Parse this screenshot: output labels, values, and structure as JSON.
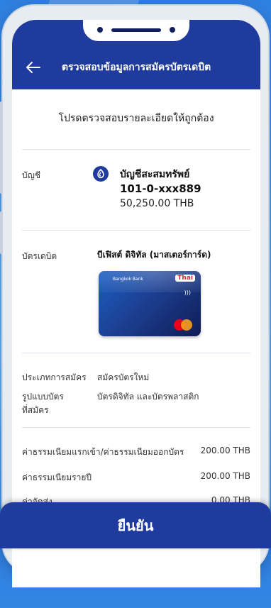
{
  "header": {
    "title": "ตรวจสอบข้อมูลการสมัครบัตรเดบิต"
  },
  "instruction": "โปรดตรวจสอบรายละเอียดให้ถูกต้อง",
  "account": {
    "label": "บัญชี",
    "type": "บัญชีสะสมทรัพย์",
    "number": "101-0-xxx889",
    "balance": "50,250.00 THB"
  },
  "debit_card": {
    "label": "บัตรเดบิต",
    "name": "บีเฟิสต์ ดิจิทัล (มาสเตอร์การ์ด)",
    "card_bank_text": "Bangkok Bank",
    "card_brand_text": "Thai"
  },
  "application": {
    "type_label": "ประเภทการสมัคร",
    "type_value": "สมัครบัตรใหม่",
    "format_label_1": "รูปแบบบัตร",
    "format_label_2": "ที่สมัคร",
    "format_value": "บัตรดิจิทัล และบัตรพลาสติก"
  },
  "fees": [
    {
      "label": "ค่าธรรมเนียมแรกเข้า/ค่าธรรมเนียมออกบัตร",
      "value": "200.00 THB"
    },
    {
      "label": "ค่าธรรมเนียมรายปี",
      "value": "200.00 THB"
    },
    {
      "label": "ค่าจัดส่ง",
      "value": "0.00 THB"
    }
  ],
  "confirm_button": "ยืนยัน",
  "colors": {
    "primary": "#1f3b9e",
    "background": "#3f95ea"
  }
}
